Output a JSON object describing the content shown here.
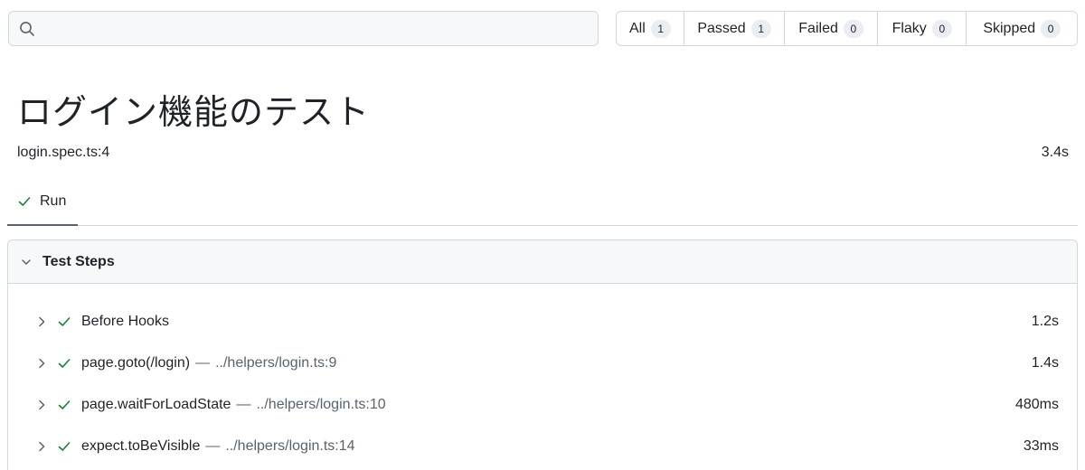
{
  "search": {
    "placeholder": "",
    "value": ""
  },
  "filters": [
    {
      "label": "All",
      "count": "1"
    },
    {
      "label": "Passed",
      "count": "1"
    },
    {
      "label": "Failed",
      "count": "0"
    },
    {
      "label": "Flaky",
      "count": "0"
    },
    {
      "label": "Skipped",
      "count": "0"
    }
  ],
  "test": {
    "title": "ログイン機能のテスト",
    "location": "login.spec.ts:4",
    "duration": "3.4s"
  },
  "tabs": [
    {
      "label": "Run",
      "status": "passed"
    }
  ],
  "steps_section": {
    "label": "Test Steps",
    "steps": [
      {
        "name": "Before Hooks",
        "separator": "",
        "source": "",
        "time": "1.2s"
      },
      {
        "name": "page.goto(/login)",
        "separator": "—",
        "source": "../helpers/login.ts:9",
        "time": "1.4s"
      },
      {
        "name": "page.waitForLoadState",
        "separator": "—",
        "source": "../helpers/login.ts:10",
        "time": "480ms"
      },
      {
        "name": "expect.toBeVisible",
        "separator": "—",
        "source": "../helpers/login.ts:14",
        "time": "33ms"
      }
    ]
  },
  "colors": {
    "pass": "#1a7f37",
    "border": "#d1d9e0",
    "muted": "#59636e",
    "header_bg": "#f6f8fa"
  }
}
